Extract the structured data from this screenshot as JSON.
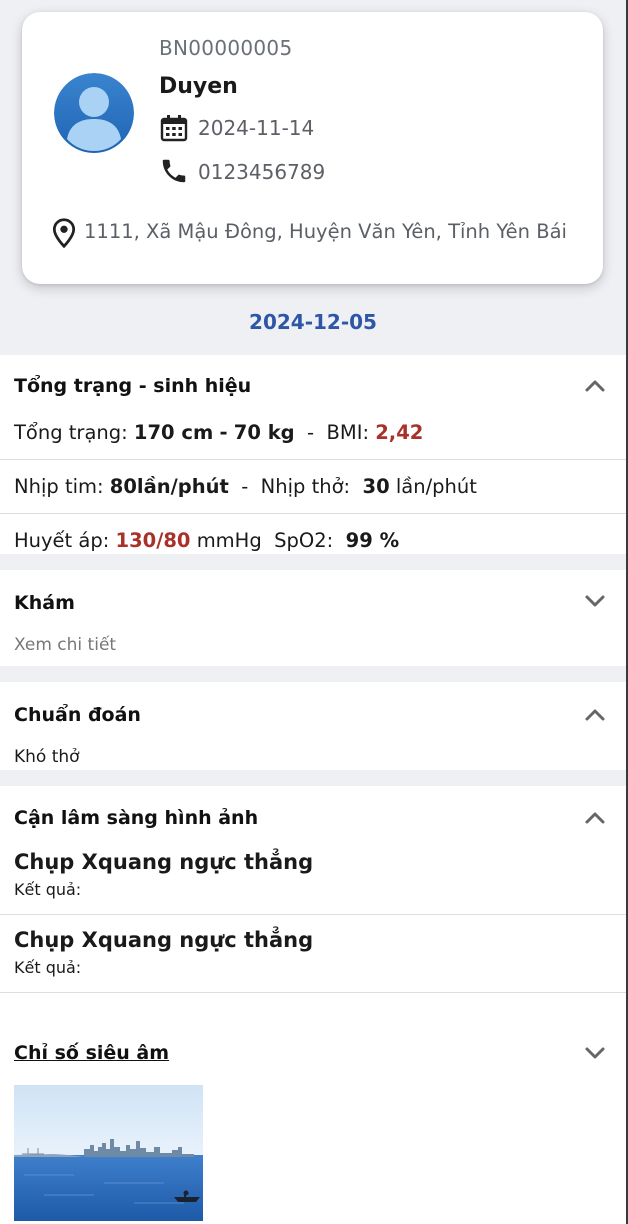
{
  "patient": {
    "id": "BN00000005",
    "name": "Duyen",
    "dob": "2024-11-14",
    "phone": "0123456789",
    "address": "1111, Xã Mậu Đông, Huyện Văn Yên, Tỉnh Yên Bái",
    "avatar_icon": "user-avatar-icon"
  },
  "visit_date": "2024-12-05",
  "vitals": {
    "title": "Tổng trạng - sinh hiệu",
    "expanded": true,
    "general_label": "Tổng trạng:",
    "height": "170 cm",
    "dash1": "-",
    "weight": "70 kg",
    "sep1": "-",
    "bmi_label": "BMI:",
    "bmi_value": "2,42",
    "hr_label": "Nhịp tim:",
    "hr_value": "80lần/phút",
    "sep2": "-",
    "rr_label": "Nhịp thở:",
    "rr_value": "30",
    "rr_unit": "lần/phút",
    "bp_label": "Huyết áp:",
    "bp_value": "130/80",
    "bp_unit": "mmHg",
    "spo2_label": "SpO2:",
    "spo2_value": "99 %"
  },
  "exam": {
    "title": "Khám",
    "expanded": false,
    "detail_link": "Xem chi tiết"
  },
  "diagnosis": {
    "title": "Chuẩn đoán",
    "expanded": true,
    "value": "Khó thở"
  },
  "imaging": {
    "title": "Cận lâm sàng hình ảnh",
    "expanded": true,
    "items": [
      {
        "name": "Chụp Xquang ngực thẳng",
        "result_label": "Kết quả:"
      },
      {
        "name": "Chụp Xquang ngực thẳng",
        "result_label": "Kết quả:"
      }
    ]
  },
  "ultrasound": {
    "title": "Chỉ số siêu âm",
    "expanded": false,
    "thumbnail": "ultrasound-thumbnail-image"
  },
  "colors": {
    "accent": "#2e56a6",
    "alert": "#a8322a",
    "background": "#eef0f4"
  }
}
